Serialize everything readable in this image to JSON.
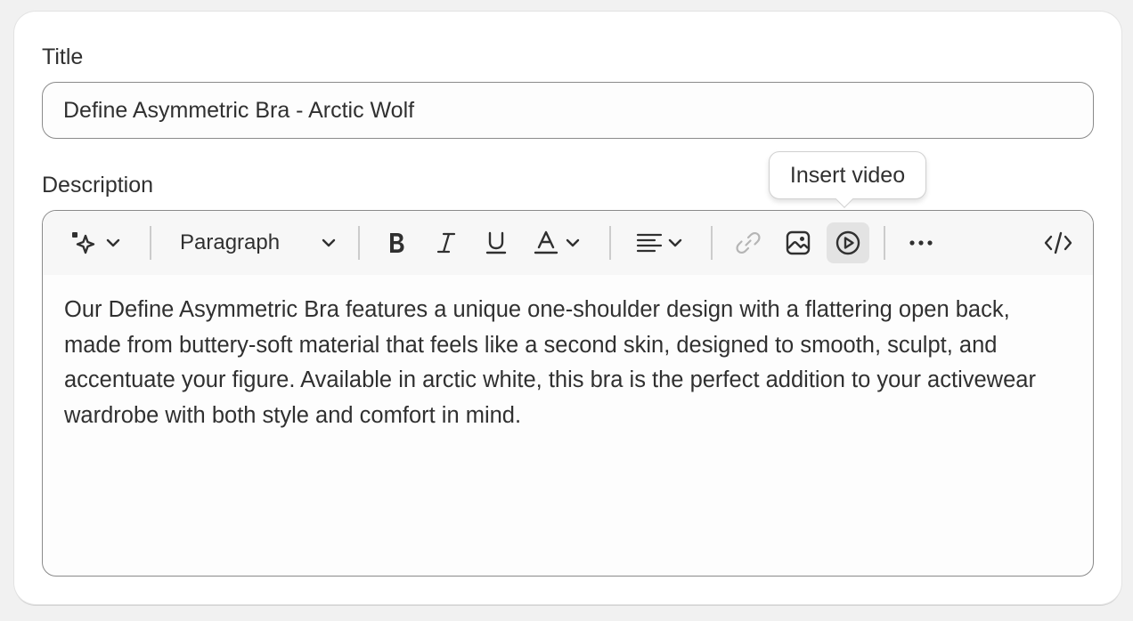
{
  "title_field": {
    "label": "Title",
    "value": "Define Asymmetric Bra - Arctic Wolf"
  },
  "description_field": {
    "label": "Description",
    "toolbar": {
      "ai_icon": "sparkle-icon",
      "format_select": "Paragraph",
      "bold_icon": "bold-icon",
      "italic_icon": "italic-icon",
      "underline_icon": "underline-icon",
      "text_color_icon": "text-color-icon",
      "align_icon": "align-left-icon",
      "link_icon": "link-icon",
      "image_icon": "image-icon",
      "video_icon": "play-circle-icon",
      "more_icon": "more-horizontal-icon",
      "code_icon": "code-icon"
    },
    "content": "Our Define Asymmetric Bra features a unique one-shoulder design with a flattering open back, made from buttery-soft material that feels like a second skin, designed to smooth, sculpt, and accentuate your figure. Available in arctic white, this bra is the perfect addition to your activewear wardrobe with both style and comfort in mind."
  },
  "tooltip": {
    "text": "Insert video"
  },
  "colors": {
    "page_bg": "#f1f1f1",
    "card_bg": "#ffffff",
    "border": "#8a8a8a",
    "toolbar_bg": "#f7f7f7",
    "active_button_bg": "#e3e3e3",
    "disabled_icon": "#b5b5b5",
    "text": "#303030"
  }
}
